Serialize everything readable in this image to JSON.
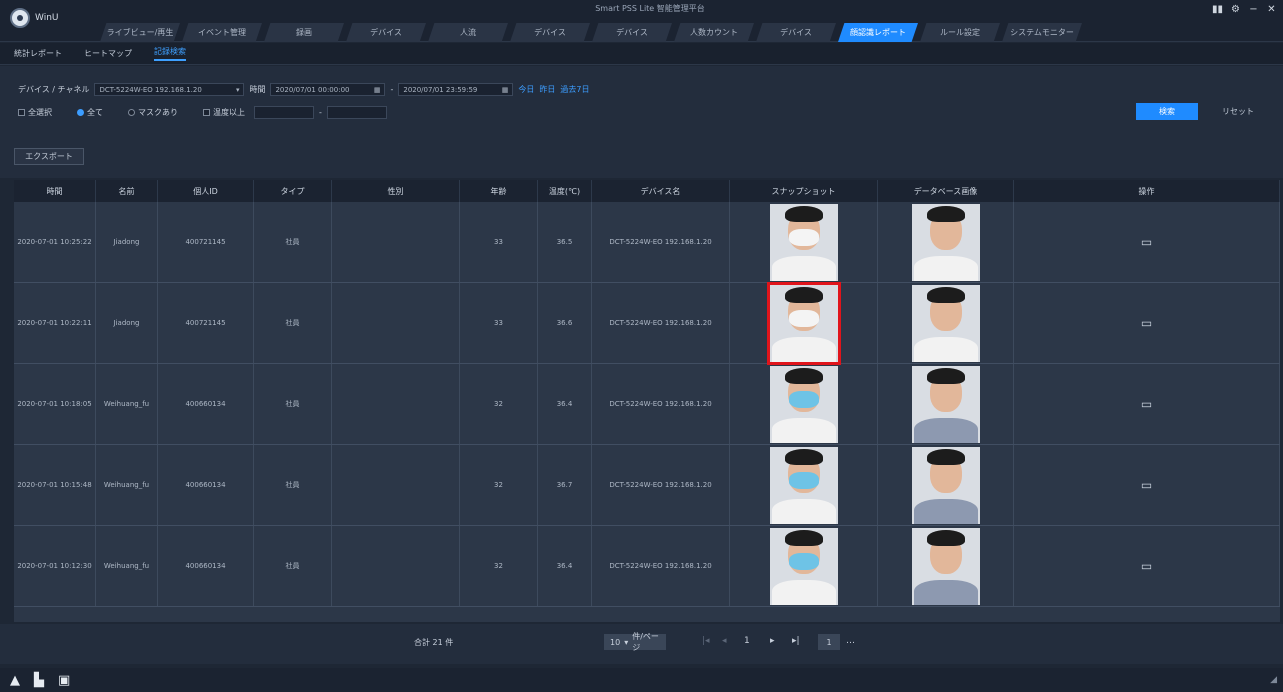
{
  "app": {
    "logo_text": "WinU",
    "window_title": "Smart PSS Lite 智能管理平台"
  },
  "window_controls": [
    "▮▮",
    "⚙",
    "−",
    "✕"
  ],
  "tabs": [
    "ライブビュー/再生",
    "イベント管理",
    "録画",
    "デバイス",
    "人流",
    "デバイス",
    "デバイス",
    "人数カウント",
    "デバイス",
    "顔認識レポート",
    "ルール設定",
    "システムモニター"
  ],
  "active_tab": 9,
  "subtabs": [
    "統計レポート",
    "ヒートマップ",
    "記録検索"
  ],
  "active_subtab": 2,
  "filters": {
    "device_label": "デバイス / チャネル",
    "device_value": "DCT-5224W-EO 192.168.1.20",
    "time_label": "時間",
    "start_time": "2020/07/01 00:00:00",
    "end_time": "2020/07/01 23:59:59",
    "quick_links": [
      "今日",
      "昨日",
      "過去7日"
    ],
    "all_label": "全選択",
    "radios": [
      "全て",
      "マスクあり"
    ],
    "checkbox_label": "温度以上",
    "search_button": "検索",
    "reset_button": "リセット",
    "export_button": "エクスポート"
  },
  "table": {
    "columns": [
      "時間",
      "名前",
      "個人ID",
      "タイプ",
      "性別",
      "年齢",
      "温度(℃)",
      "デバイス名",
      "スナップショット",
      "データベース画像",
      "操作"
    ],
    "rows": [
      {
        "time": "2020-07-01 10:25:22",
        "name": "Jiadong",
        "id": "400721145",
        "type": "社員",
        "gender": "",
        "age": "33",
        "temp": "36.5",
        "device": "DCT-5224W-EO 192.168.1.20",
        "op": "▭",
        "mask": "white",
        "ref": "white"
      },
      {
        "time": "2020-07-01 10:22:11",
        "name": "Jiadong",
        "id": "400721145",
        "type": "社員",
        "gender": "",
        "age": "33",
        "temp": "36.6",
        "device": "DCT-5224W-EO 192.168.1.20",
        "op": "▭",
        "mask": "white",
        "ref": "white"
      },
      {
        "time": "2020-07-01 10:18:05",
        "name": "Weihuang_fu",
        "id": "400660134",
        "type": "社員",
        "gender": "",
        "age": "32",
        "temp": "36.4",
        "device": "DCT-5224W-EO 192.168.1.20",
        "op": "▭",
        "mask": "blue",
        "ref": "pattern"
      },
      {
        "time": "2020-07-01 10:15:48",
        "name": "Weihuang_fu",
        "id": "400660134",
        "type": "社員",
        "gender": "",
        "age": "32",
        "temp": "36.7",
        "device": "DCT-5224W-EO 192.168.1.20",
        "op": "▭",
        "mask": "blue",
        "ref": "pattern"
      },
      {
        "time": "2020-07-01 10:12:30",
        "name": "Weihuang_fu",
        "id": "400660134",
        "type": "社員",
        "gender": "",
        "age": "32",
        "temp": "36.4",
        "device": "DCT-5224W-EO 192.168.1.20",
        "op": "▭",
        "mask": "blue",
        "ref": "pattern"
      }
    ]
  },
  "pager": {
    "total_text": "合計 21 件",
    "page_size": "10",
    "per_page_label": "件/ページ",
    "current_page": "1",
    "goto_value": "1"
  },
  "colors": {
    "accent": "#1f8bff",
    "selection": "#e0141b"
  }
}
